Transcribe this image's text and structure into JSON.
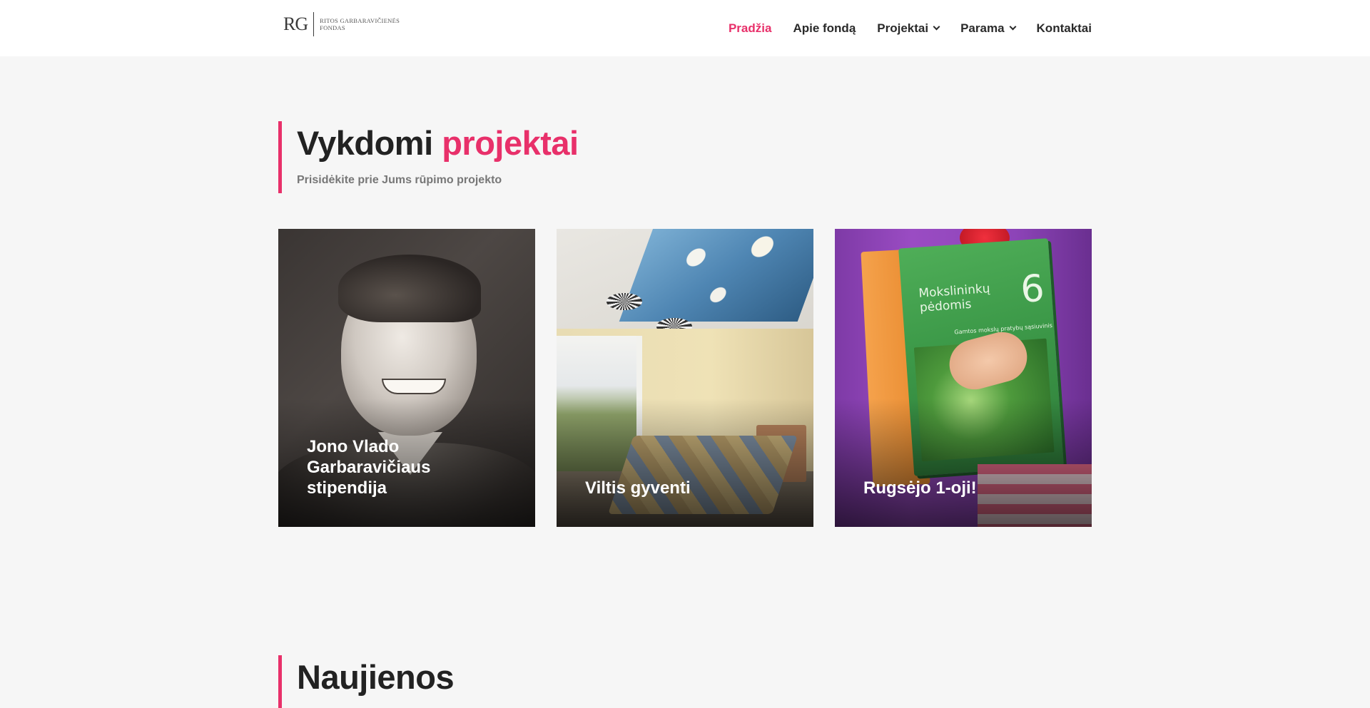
{
  "header": {
    "logo": {
      "mark": "RG",
      "line1": "RITOS GARBARAVIČIENĖS",
      "line2": "FONDAS"
    },
    "nav": [
      {
        "label": "Pradžia",
        "active": true,
        "dropdown": false
      },
      {
        "label": "Apie fondą",
        "active": false,
        "dropdown": false
      },
      {
        "label": "Projektai",
        "active": false,
        "dropdown": true
      },
      {
        "label": "Parama",
        "active": false,
        "dropdown": true
      },
      {
        "label": "Kontaktai",
        "active": false,
        "dropdown": false
      }
    ]
  },
  "projects_section": {
    "title_main": "Vykdomi",
    "title_accent": "projektai",
    "subtitle": "Prisidėkite prie Jums rūpimo projekto",
    "cards": [
      {
        "title": "Jono Vlado Garbaravičiaus stipendija"
      },
      {
        "title": "Viltis gyventi"
      },
      {
        "title": "Rugsėjo 1-oji!"
      }
    ],
    "book": {
      "title": "Mokslininkų pėdomis",
      "number": "6",
      "subtitle": "Gamtos mokslų pratybų sąsiuvinis"
    }
  },
  "news_section": {
    "title": "Naujienos"
  },
  "colors": {
    "accent": "#e8306a",
    "text_dark": "#222222",
    "background": "#f6f6f6",
    "header_bg": "#ffffff"
  }
}
